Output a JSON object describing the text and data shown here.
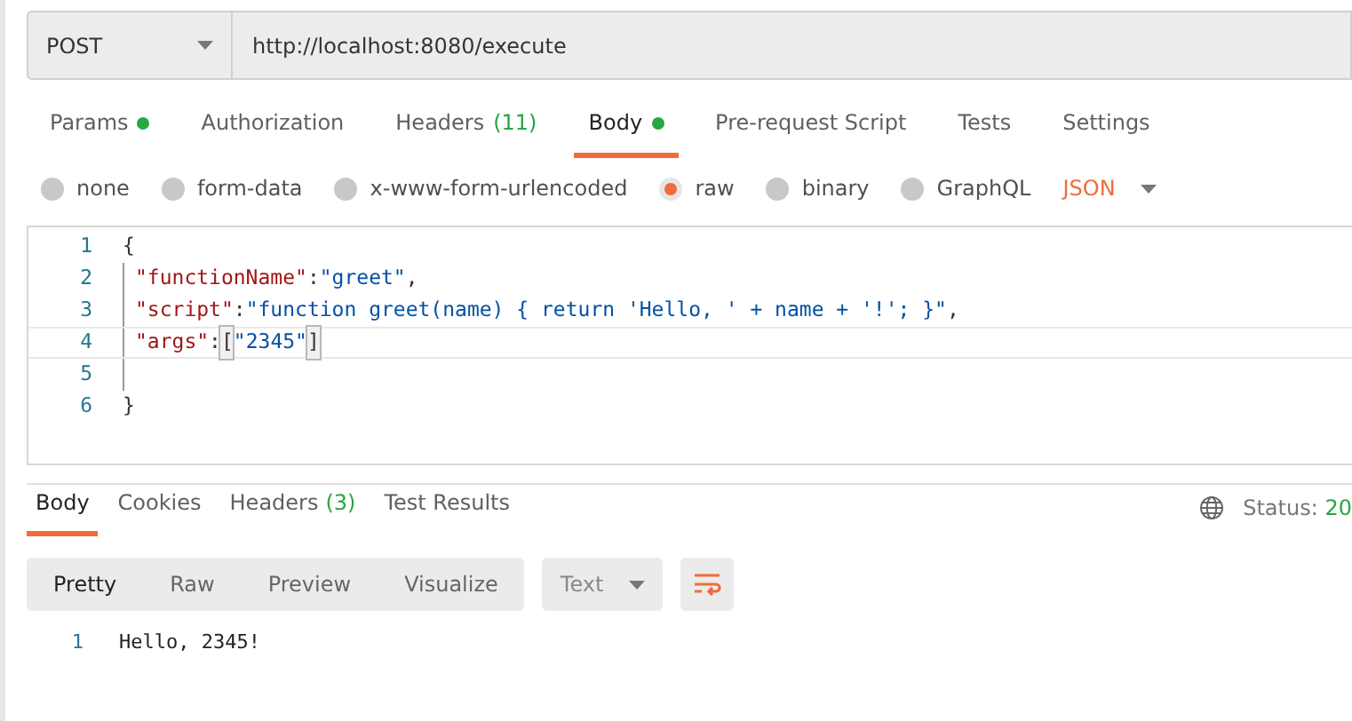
{
  "request": {
    "method": "POST",
    "url": "http://localhost:8080/execute"
  },
  "request_tabs": [
    {
      "label": "Params",
      "dot": true,
      "selected": false
    },
    {
      "label": "Authorization",
      "dot": false,
      "selected": false
    },
    {
      "label": "Headers",
      "count": "(11)",
      "dot": false,
      "selected": false
    },
    {
      "label": "Body",
      "dot": true,
      "selected": true
    },
    {
      "label": "Pre-request Script",
      "dot": false,
      "selected": false
    },
    {
      "label": "Tests",
      "dot": false,
      "selected": false
    },
    {
      "label": "Settings",
      "dot": false,
      "selected": false
    }
  ],
  "body_types": [
    {
      "label": "none",
      "selected": false
    },
    {
      "label": "form-data",
      "selected": false
    },
    {
      "label": "x-www-form-urlencoded",
      "selected": false
    },
    {
      "label": "raw",
      "selected": true
    },
    {
      "label": "binary",
      "selected": false
    },
    {
      "label": "GraphQL",
      "selected": false
    }
  ],
  "body_format": "JSON",
  "editor": {
    "lines": [
      {
        "number": "1",
        "tokens": [
          {
            "kind": "punct",
            "text": "{"
          }
        ]
      },
      {
        "number": "2",
        "tokens": [
          {
            "kind": "key",
            "text": "\"functionName\""
          },
          {
            "kind": "punct",
            "text": ":"
          },
          {
            "kind": "string",
            "text": "\"greet\""
          },
          {
            "kind": "punct",
            "text": ","
          }
        ]
      },
      {
        "number": "3",
        "tokens": [
          {
            "kind": "key",
            "text": "\"script\""
          },
          {
            "kind": "punct",
            "text": ":"
          },
          {
            "kind": "string",
            "text": "\"function greet(name) { return 'Hello, ' + name + '!'; }\""
          },
          {
            "kind": "punct",
            "text": ","
          }
        ]
      },
      {
        "number": "4",
        "tokens": [
          {
            "kind": "key",
            "text": "\"args\""
          },
          {
            "kind": "punct",
            "text": ":"
          },
          {
            "kind": "bracket",
            "text": "["
          },
          {
            "kind": "string",
            "text": "\"2345\""
          },
          {
            "kind": "bracket",
            "text": "]"
          }
        ]
      },
      {
        "number": "5"
      },
      {
        "number": "6",
        "tokens": [
          {
            "kind": "punct",
            "text": "}"
          }
        ]
      }
    ]
  },
  "response_tabs": [
    {
      "label": "Body",
      "selected": true
    },
    {
      "label": "Cookies",
      "selected": false
    },
    {
      "label": "Headers",
      "count": "(3)",
      "selected": false
    },
    {
      "label": "Test Results",
      "selected": false
    }
  ],
  "status": {
    "label": "Status:",
    "value": "20"
  },
  "view_modes": [
    {
      "label": "Pretty",
      "selected": true
    },
    {
      "label": "Raw",
      "selected": false
    },
    {
      "label": "Preview",
      "selected": false
    },
    {
      "label": "Visualize",
      "selected": false
    }
  ],
  "response_format": "Text",
  "output": [
    {
      "number": "1",
      "text": "Hello, 2345!"
    }
  ]
}
